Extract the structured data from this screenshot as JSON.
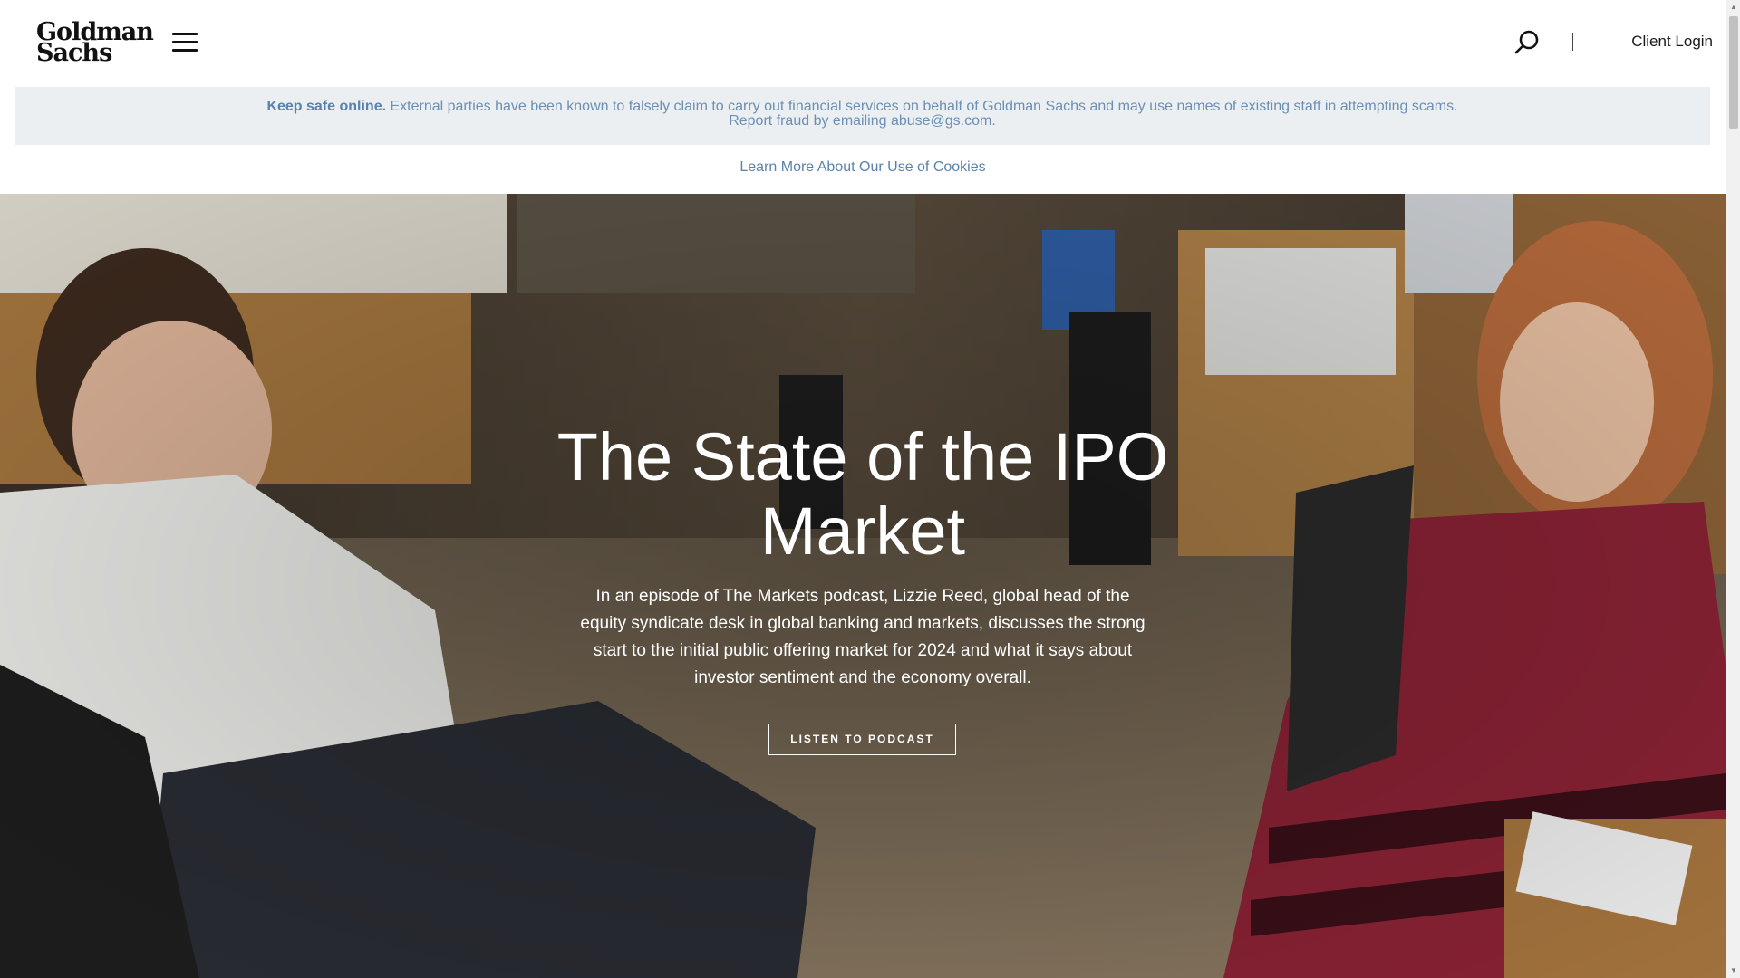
{
  "header": {
    "logo_line1": "Goldman",
    "logo_line2": "Sachs",
    "menu_icon": "hamburger-menu-icon",
    "search_icon": "search-icon",
    "client_login": "Client Login"
  },
  "alert": {
    "strong": "Keep safe online.",
    "line1": "External parties have been known to falsely claim to carry out financial services on behalf of Goldman Sachs and may use names of existing staff in attempting scams.",
    "line2": "Report fraud by emailing abuse@gs.com."
  },
  "cookies": {
    "link": "Learn More About Our Use of Cookies"
  },
  "hero": {
    "title": "The State of the IPO Market",
    "description": "In an episode of The Markets podcast, Lizzie Reed, global head of the equity syndicate desk in global banking and markets, discusses the strong start to the initial public offering market for 2024 and what it says about investor sentiment and the economy overall.",
    "button": "LISTEN TO PODCAST"
  },
  "colors": {
    "link_blue": "#5a82ad",
    "alert_bg": "#ebeff2"
  }
}
